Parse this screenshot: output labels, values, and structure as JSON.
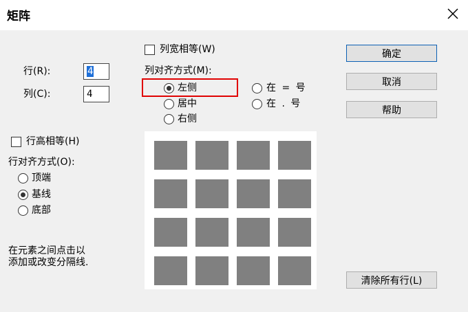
{
  "dialog": {
    "title": "矩阵",
    "close_icon": "close-icon"
  },
  "rows": {
    "label": "行(R):",
    "value": "4"
  },
  "cols": {
    "label": "列(C):",
    "value": "4"
  },
  "row_equal": {
    "label": "行高相等(H)",
    "checked": false
  },
  "row_align": {
    "label": "行对齐方式(O):",
    "options": [
      {
        "label": "顶端",
        "checked": false
      },
      {
        "label": "基线",
        "checked": true
      },
      {
        "label": "底部",
        "checked": false
      }
    ]
  },
  "col_equal": {
    "label": "列宽相等(W)",
    "checked": false
  },
  "col_align": {
    "label": "列对齐方式(M):",
    "options": [
      {
        "label": "左侧",
        "checked": true
      },
      {
        "label": "居中",
        "checked": false
      },
      {
        "label": "右侧",
        "checked": false
      },
      {
        "label": "在 = 号",
        "checked": false
      },
      {
        "label": "在 . 号",
        "checked": false
      }
    ]
  },
  "hint": {
    "line1": "在元素之间点击以",
    "line2": "添加或改变分隔线."
  },
  "buttons": {
    "ok": "确定",
    "cancel": "取消",
    "help": "帮助",
    "clear_lines": "清除所有行(L)"
  },
  "preview": {
    "rows": 4,
    "cols": 4,
    "cell_color": "#808080"
  },
  "colors": {
    "highlight": "#e00000",
    "focus_border": "#0a5fb4",
    "dialog_bg": "#f0f0f0"
  }
}
